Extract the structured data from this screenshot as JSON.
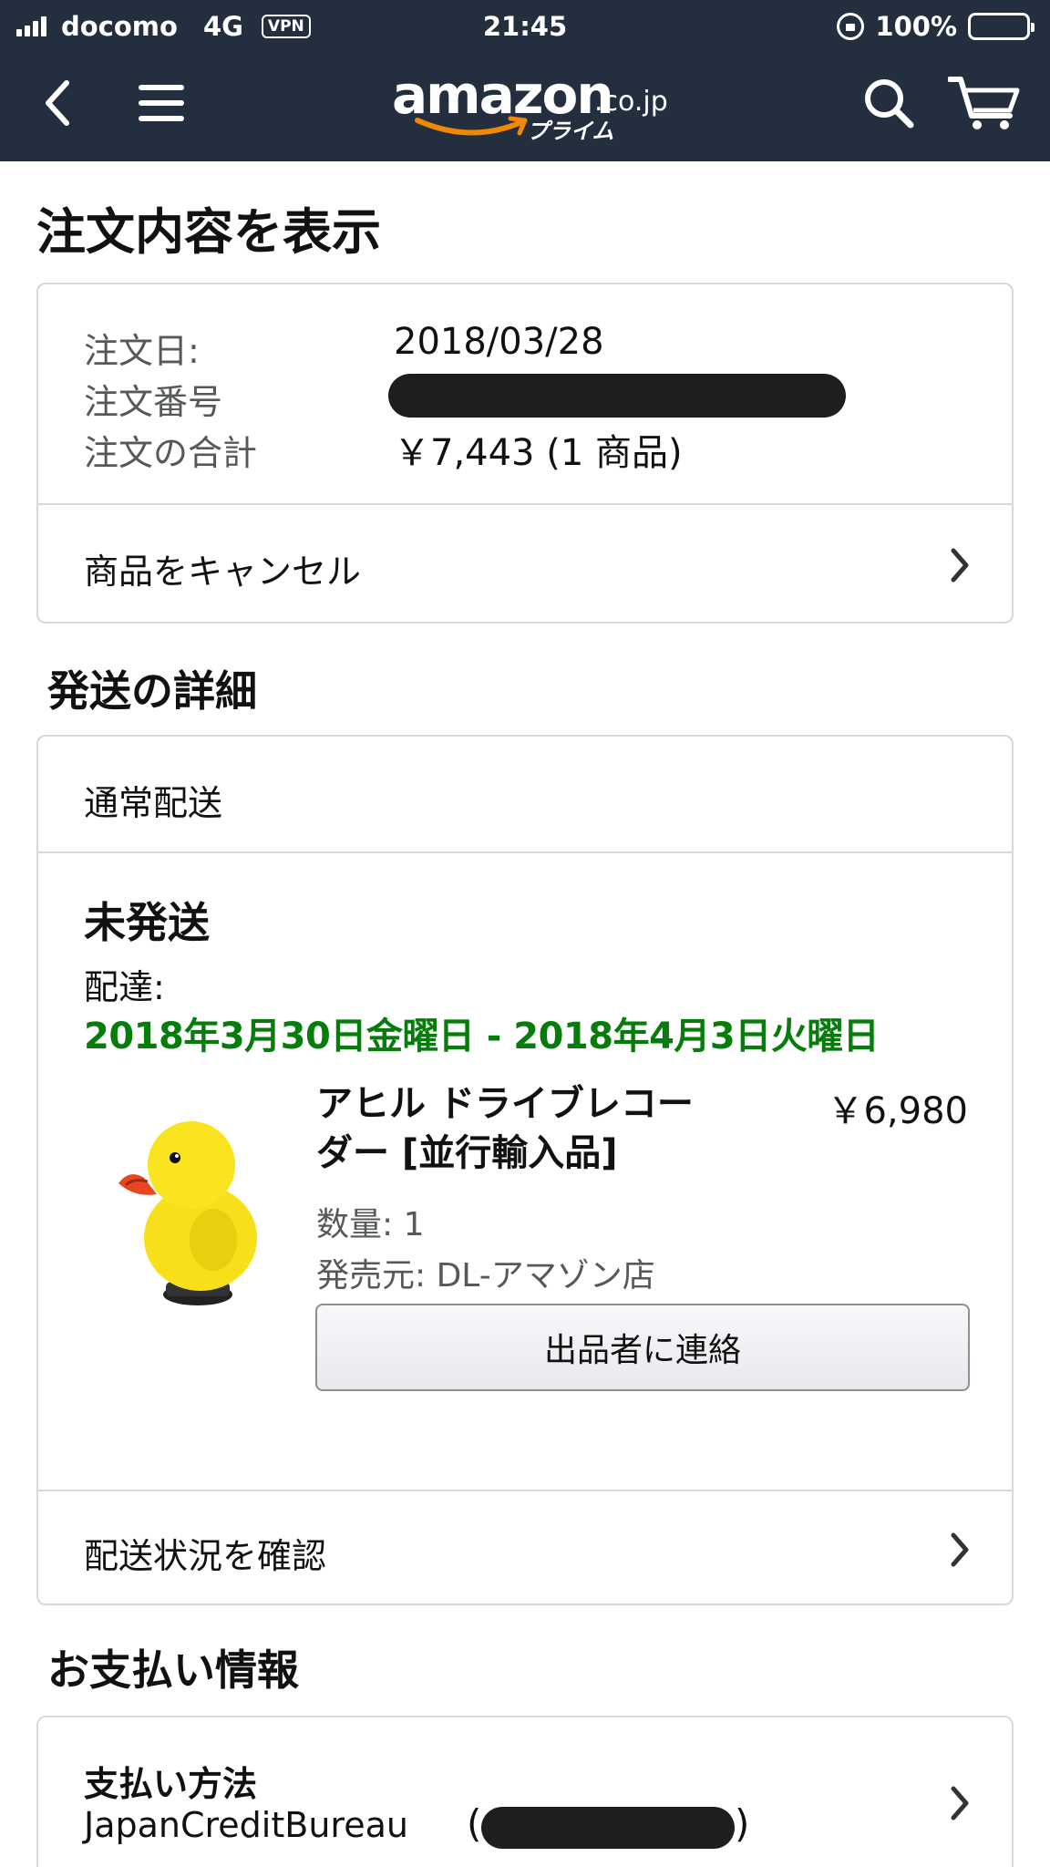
{
  "status_bar": {
    "carrier": "docomo",
    "network": "4G",
    "vpn": "VPN",
    "time": "21:45",
    "battery": "100%"
  },
  "colors": {
    "header_bg": "#232f3e",
    "delivery_green": "#067d0b",
    "logo_smile": "#f08804",
    "battery_fill": "#ffc300"
  },
  "header": {
    "logo_text": "amazon",
    "logo_tld": ".co.jp",
    "logo_sub": "プライム",
    "icons": [
      "back-icon",
      "menu-icon",
      "search-icon",
      "cart-icon"
    ]
  },
  "page_title": "注文内容を表示",
  "order_summary": {
    "date_label": "注文日:",
    "date_value": "2018/03/28",
    "number_label": "注文番号",
    "total_label": "注文の合計",
    "total_value": "￥7,443 (1 商品)",
    "cancel_label": "商品をキャンセル"
  },
  "shipping": {
    "section_title": "発送の詳細",
    "method": "通常配送",
    "state": "未発送",
    "delivery_label": "配達:",
    "delivery_range": "2018年3月30日金曜日 - 2018年4月3日火曜日",
    "product": {
      "name": "アヒル ドライブレコーダー [並行輸入品]",
      "price": "￥6,980",
      "quantity": "数量: 1",
      "seller": "発売元: DL-アマゾン店"
    },
    "contact_button": "出品者に連絡",
    "track_label": "配送状況を確認"
  },
  "payment": {
    "section_title": "お支払い情報",
    "method_label": "支払い方法",
    "method_value": "JapanCreditBureau"
  }
}
